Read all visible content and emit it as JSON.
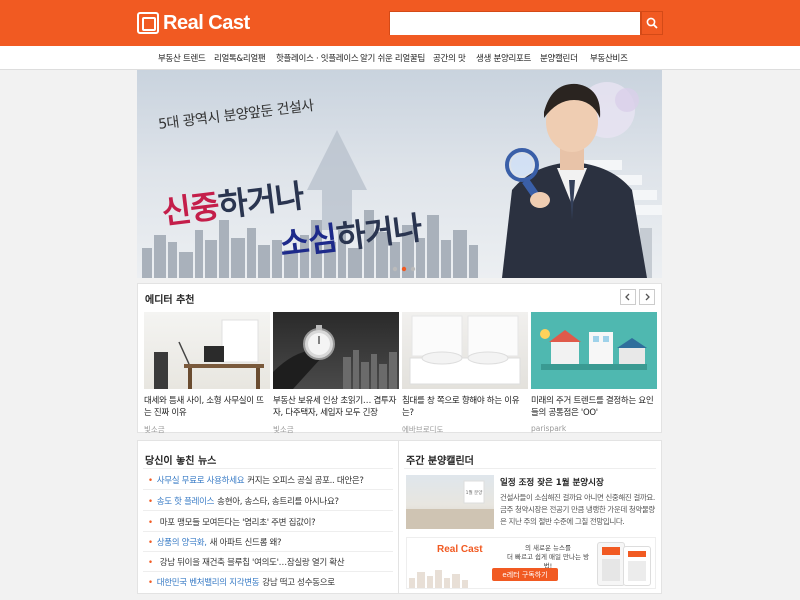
{
  "colors": {
    "brand": "#f15a22",
    "link_blue": "#3a7cc6",
    "accent_red": "#c41e4a",
    "navy": "#2a3550"
  },
  "header": {
    "logo_text": "Real Cast",
    "search": {
      "value": "",
      "placeholder": ""
    },
    "search_icon": "search-icon"
  },
  "nav": {
    "items": [
      "부동산 트렌드",
      "리얼톡&리얼팬",
      "핫플레이스 · 잇플레이스",
      "알기 쉬운 리얼꿀팁",
      "공간의 맛",
      "생생 분양리포트",
      "분양캘린더",
      "부동산비즈"
    ]
  },
  "hero": {
    "subtitle": "5대 광역시 분양앞둔 건설사",
    "line1_accent": "신중",
    "line1_rest": "하거나",
    "line2_accent": "소심",
    "line2_rest": "하거나"
  },
  "editor": {
    "title": "에디터 추천",
    "prev_icon": "chevron-left-icon",
    "next_icon": "chevron-right-icon",
    "cards": [
      {
        "title": "대세와 틈새 사이, 소형 사무실이 뜨는 진짜 이유",
        "source": "빛소금"
      },
      {
        "title": "부동산 보유세 인상 초읽기… 겹투자자, 다주택자, 세입자 모두 긴장",
        "source": "빛소금"
      },
      {
        "title": "침대를 창 쪽으로 향해야 하는 이유는?",
        "source": "에바브로디도"
      },
      {
        "title": "미래의 주거 트렌드를 결정하는 요인들의 공통점은 'OO'",
        "source": "parispark"
      }
    ]
  },
  "news": {
    "title": "당신이 놓친 뉴스",
    "items": [
      {
        "highlight": "사무실 무료로 사용하세요",
        "text": "커지는 오피스 공실 공포.. 대안은?"
      },
      {
        "highlight": "송도 핫 플레이스",
        "text": "송현아, 송스타, 송트리를 아시나요?"
      },
      {
        "highlight": "",
        "text": "마포 맹모들 모여든다는 '염리초' 주변 집값이?"
      },
      {
        "highlight": "상품의 양극화,",
        "text": "새 아파트 신드롬 왜?"
      },
      {
        "highlight": "",
        "text": "강남 뒤이을 재건축 블루칩 '여의도'…잠실랑 열기 확산"
      },
      {
        "highlight": "대한민국 벤처밸리의 지각변동",
        "text": "강남 떡고 성수동으로"
      }
    ]
  },
  "calendar": {
    "title": "주간 분양캘린더",
    "image_caption": "1월 분양",
    "headline": "일정 조정 잦은 1월 분양시장",
    "description": "건설사들이 소심해진 걸까요 아니면 신중해진 걸까요. 금주 청약시장은 전공기 만큼 냉랭한 가운데 청약물량은 지난 주의 절반 수준에 그칠 전망입니다."
  },
  "banner": {
    "logo": "Real Cast",
    "text_line1": "의 새로운 뉴스를",
    "text_line2": "더 빠르고 쉽게 매일 만나는 방법!",
    "button": "e레터 구독하기"
  }
}
